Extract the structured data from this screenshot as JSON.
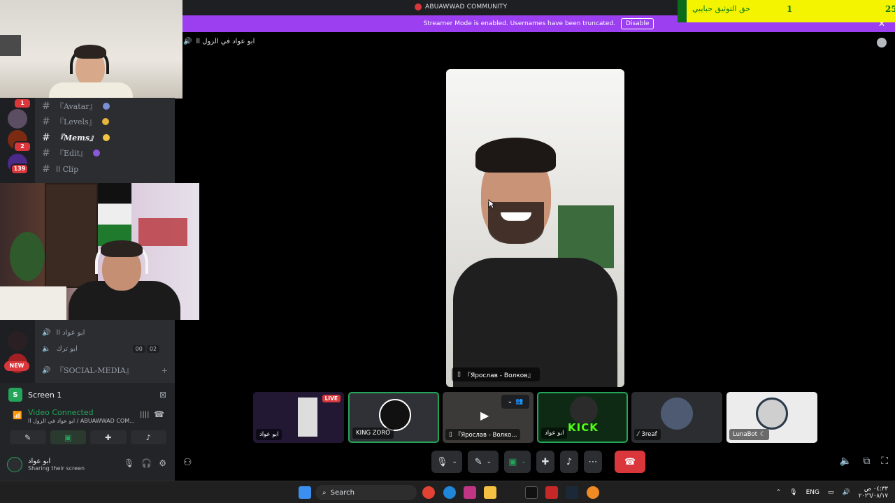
{
  "window": {
    "title": "ABUAWWAD COMMUNITY"
  },
  "streamer_banner": {
    "text": "Streamer Mode is enabled. Usernames have been truncated.",
    "disable_label": "Disable",
    "close_label": "✕"
  },
  "overlay": {
    "left_number": "25",
    "text": "حق التوثيق حبايبي",
    "right_number": "1"
  },
  "voice_header": {
    "channel": "ابو عواد في الزول اا"
  },
  "server_rail": {
    "badges": [
      "1",
      "2",
      "139"
    ],
    "new_label": "NEW"
  },
  "channels": [
    {
      "name": "『Avatar』",
      "active": false
    },
    {
      "name": "『Levels』",
      "active": false
    },
    {
      "name": "『Mems』",
      "active": true
    },
    {
      "name": "『Edit』",
      "active": false
    },
    {
      "name": "اا Clip",
      "active": false
    }
  ],
  "voice_users": [
    {
      "name": "ابو عواد اا"
    },
    {
      "name": "ابو ترك"
    }
  ],
  "voice_timer": [
    "00",
    "02"
  ],
  "social_channel": "『SOCIAL-MEDIA』",
  "status": {
    "screen_label": "Screen 1",
    "video_connected": "Video Connected",
    "connection_sub": "ابو عواد في الزول اا / ABUAWWAD COM...",
    "user_name": "ابو عواد",
    "user_status": "Sharing their screen"
  },
  "stage": {
    "label": "『Ярослав - Волков』"
  },
  "tiles": [
    {
      "label": "ابو عواد",
      "live": "LIVE"
    },
    {
      "label": "KING ZORO"
    },
    {
      "label": "『Ярослав - Волко..."
    },
    {
      "label": "ابو عواد",
      "kick": "KICK"
    },
    {
      "label": "3reaf"
    },
    {
      "label": "LunaBot"
    }
  ],
  "taskbar": {
    "search_placeholder": "Search",
    "lang": "ENG",
    "time": "٠٤:٣٣ ص",
    "date": "٢٠٢٦/٠٨/١٧"
  },
  "colors": {
    "discord_green": "#23a55a",
    "streamer_purple": "#9b3ff0",
    "hangup_red": "#da373c",
    "overlay_yellow": "#f4f400"
  }
}
